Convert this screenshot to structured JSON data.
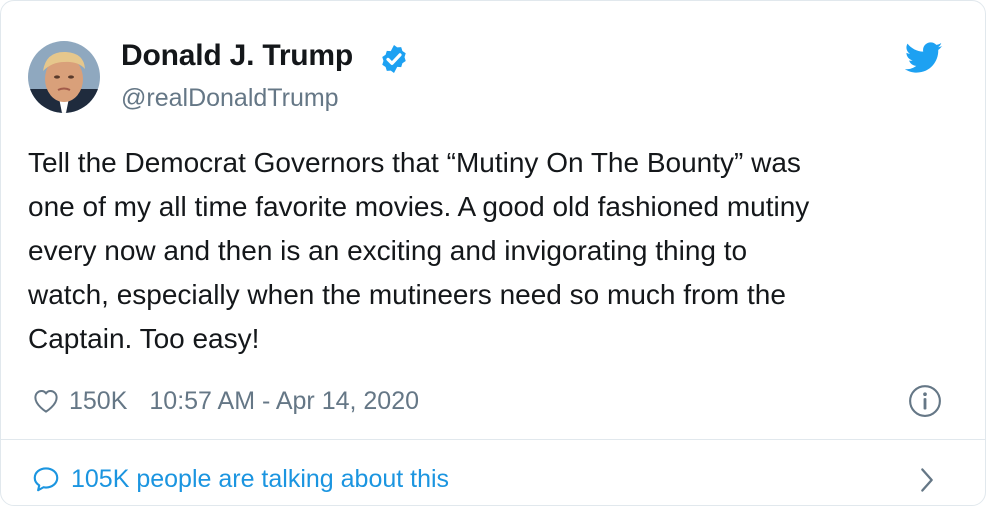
{
  "tweet": {
    "author": {
      "name": "Donald J. Trump",
      "handle": "@realDonaldTrump",
      "verified": true,
      "avatar_icon": "profile-photo"
    },
    "text": "Tell the Democrat Governors that “Mutiny On The Bounty” was\none of my all time favorite movies. A good old fashioned mutiny\nevery now and then is an exciting and invigorating thing to\nwatch, especially when the mutineers need so much from the\nCaptain. Too easy!",
    "likes": "150K",
    "timestamp": "10:57 AM - Apr 14, 2020",
    "conversation_label": "105K people are talking about this"
  },
  "icons": {
    "brand": "twitter-bird-icon",
    "verified": "verified-badge-icon",
    "like": "heart-icon",
    "info": "info-icon",
    "conversation": "speech-bubble-icon",
    "more": "chevron-right-icon"
  },
  "colors": {
    "brand_blue": "#1da1f2",
    "link_blue": "#1b95e0",
    "secondary_text": "#657786",
    "primary_text": "#14171a",
    "border": "#e1e8ed"
  }
}
